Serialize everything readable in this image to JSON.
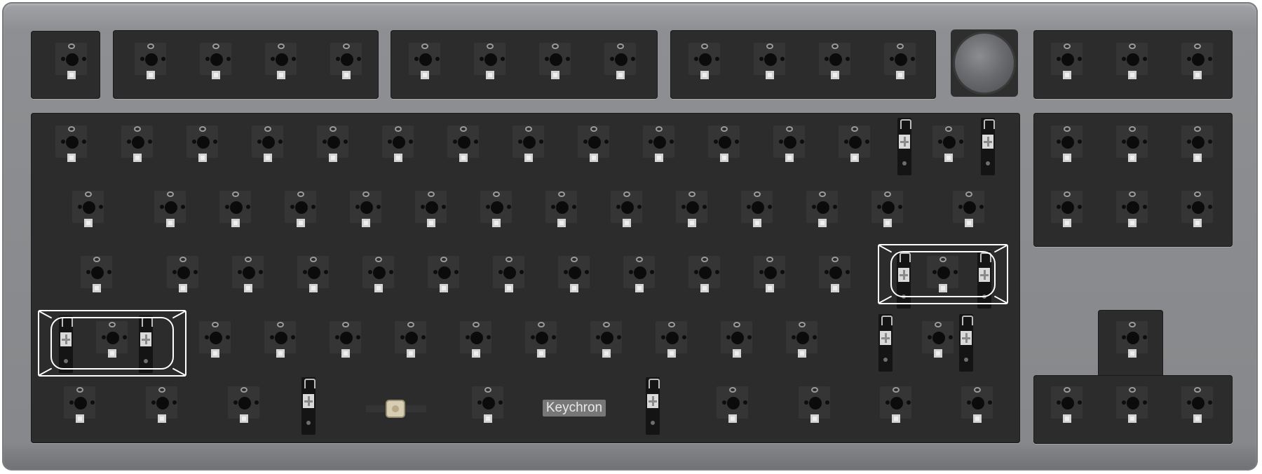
{
  "keyboard": {
    "brand_label": "Keychron",
    "colors": {
      "case": "#8d8f92",
      "plate": "#2c2c2c",
      "led_pad": "#efefef",
      "highlight": "#ffffff"
    },
    "icons": [
      "rotary-knob-icon",
      "reset-button-icon",
      "stabilizer-icon"
    ]
  }
}
